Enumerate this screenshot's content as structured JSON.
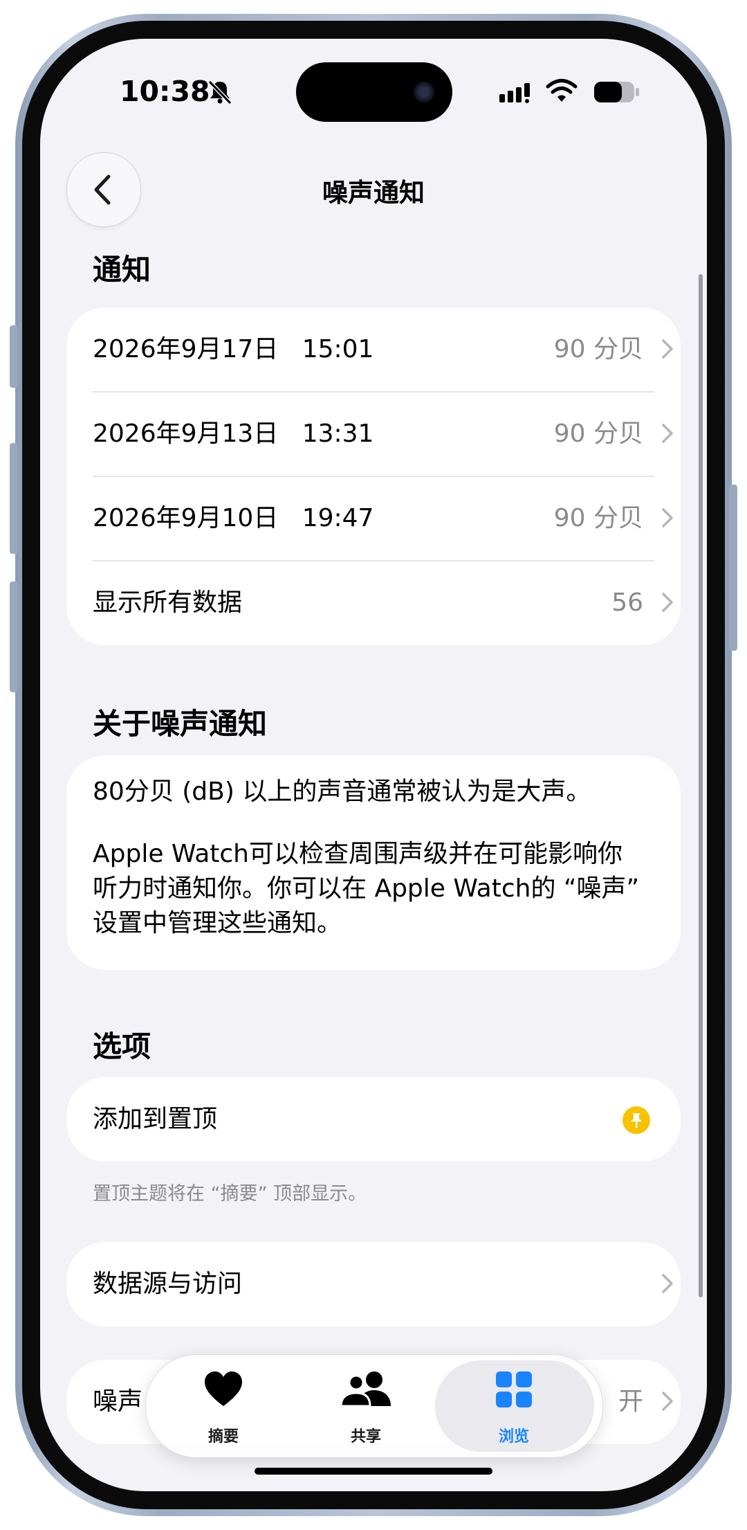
{
  "status_bar": {
    "time": "10:38"
  },
  "nav": {
    "title": "噪声通知"
  },
  "notifications": {
    "header": "通知",
    "rows": [
      {
        "date": "2026年9月17日",
        "time": "15:01",
        "value": "90 分贝"
      },
      {
        "date": "2026年9月13日",
        "time": "13:31",
        "value": "90 分贝"
      },
      {
        "date": "2026年9月10日",
        "time": "19:47",
        "value": "90 分贝"
      }
    ],
    "show_all": {
      "label": "显示所有数据",
      "count": "56"
    }
  },
  "about": {
    "header": "关于噪声通知",
    "paragraph1": "80分贝 (dB) 以上的声音通常被认为是大声。",
    "paragraph2_line1": "Apple Watch可以检查周围声级并在可能影响你",
    "paragraph2_line2": "听力时通知你。你可以在 Apple Watch的 “噪声”",
    "paragraph2_line3": "设置中管理这些通知。"
  },
  "options": {
    "header": "选项",
    "pin_label": "添加到置顶",
    "pin_footnote": "置顶主题将在 “摘要” 顶部显示。",
    "data_sources_label": "数据源与访问",
    "partial_row_label": "噪声",
    "partial_row_value": "开"
  },
  "tabbar": {
    "tabs": [
      {
        "label": "摘要",
        "icon": "heart-icon"
      },
      {
        "label": "共享",
        "icon": "people-icon"
      },
      {
        "label": "浏览",
        "icon": "grid-icon",
        "active": true
      }
    ]
  },
  "colors": {
    "accent": "#1a84ff",
    "pin": "#f7c300",
    "background": "#f2f2f7",
    "secondary_text": "#8a8a8e"
  }
}
